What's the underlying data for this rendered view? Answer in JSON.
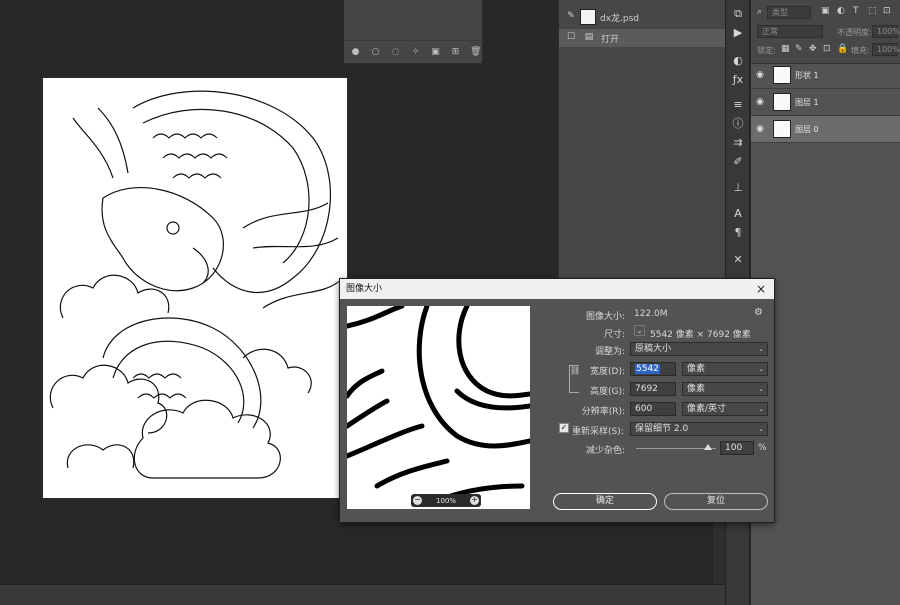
{
  "history": {
    "snapshot_label": "dx龙.psd",
    "open_label": "打开"
  },
  "layers": {
    "search_placeholder": "类型",
    "blend_mode": "正常",
    "opacity_label": "不透明度:",
    "opacity_value": "100%",
    "lock_label": "锁定:",
    "fill_label": "填充:",
    "fill_value": "100%",
    "items": [
      {
        "name": "形状 1"
      },
      {
        "name": "图层 1"
      },
      {
        "name": "图层 0"
      }
    ]
  },
  "dialog": {
    "title": "图像大小",
    "close": "×",
    "size_label": "图像大小:",
    "size_value": "122.0M",
    "dimensions_label": "尺寸:",
    "dimensions_value": "5542 像素  ×  7692 像素",
    "fit_label": "调整为:",
    "fit_value": "原稿大小",
    "width_label": "宽度(D):",
    "width_value": "5542",
    "width_unit": "像素",
    "height_label": "高度(G):",
    "height_value": "7692",
    "height_unit": "像素",
    "resolution_label": "分辨率(R):",
    "resolution_value": "600",
    "resolution_unit": "像素/英寸",
    "resample_label": "重新采样(S):",
    "resample_value": "保留细节 2.0",
    "noise_label": "减少杂色:",
    "noise_value": "100",
    "noise_unit": "%",
    "noise_level": 0.9,
    "zoom_level": "100%",
    "ok_label": "确定",
    "reset_label": "复位"
  }
}
